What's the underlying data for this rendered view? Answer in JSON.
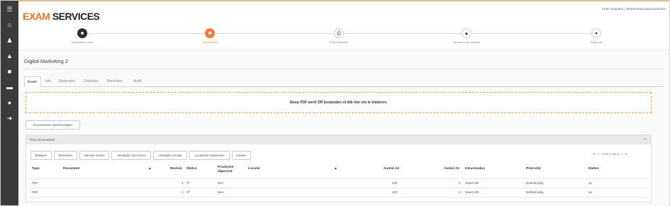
{
  "app": {
    "logo_part1": "EXAM",
    "logo_part2": "SERVICES",
    "user": "Peter Sampers | Tentamenbureaucoördinator"
  },
  "sidebar": {
    "icons": [
      "menu-icon",
      "home-icon",
      "user-graduate-icon",
      "road-icon",
      "briefcase-icon",
      "folder-icon",
      "user-icon",
      "logout-icon"
    ]
  },
  "steps": [
    {
      "label": "Aanmaken Exam",
      "icon": "briefcase-icon",
      "state": "done"
    },
    {
      "label": "Verbeteblad",
      "icon": "gear-icon",
      "state": "active"
    },
    {
      "label": "Print Productie",
      "icon": "printer-icon",
      "state": "todo"
    },
    {
      "label": "Verzoek naar afname",
      "icon": "road-icon",
      "state": "todo"
    },
    {
      "label": "Afgerond",
      "icon": "graduation-cap-icon",
      "state": "todo"
    }
  ],
  "page": {
    "title": "Digital Marketing 2"
  },
  "tabs": [
    "Exam",
    "Info",
    "Studenten",
    "Diensten",
    "Berichten",
    "Audit"
  ],
  "dropzone": {
    "text": "Sleep PDF en/of ZIP bestanden of klik hier om te bladeren."
  },
  "merge_button": "Documenten samenvoegen",
  "panel": {
    "title": "Print documenten",
    "collapse": "−"
  },
  "toolbar": [
    "Bekijken",
    "Bewerken",
    "Nieuwe revisie",
    "Verwijder document",
    "Verwijder locatie",
    "Locatie(s) toekennen",
    "Zoeken"
  ],
  "pager": {
    "first": "⇤",
    "prev": "«",
    "text": "1 tot 2 van 2",
    "next": "»",
    "last": "⇥"
  },
  "table": {
    "headers": [
      "Type",
      "Document",
      "▲",
      "Revisie",
      "Status",
      "Productie afgerond",
      "Locatie",
      "▲",
      "Aantal A4",
      "Aantal A3",
      "Kleurmodus",
      "Print stijl",
      "Nieten"
    ],
    "rows": [
      {
        "type": "PDF",
        "revisie": "1",
        "productie": "Nee",
        "a4": "100",
        "a3": "2",
        "kleur": "Zwart-Wit",
        "stijl": "Dubbelzijdig",
        "nieten": "Ja"
      },
      {
        "type": "PDF",
        "revisie": "1",
        "productie": "Nee",
        "a4": "100",
        "a3": "2",
        "kleur": "Zwart-Wit",
        "stijl": "Dubbelzijdig",
        "nieten": "Ja"
      }
    ]
  }
}
